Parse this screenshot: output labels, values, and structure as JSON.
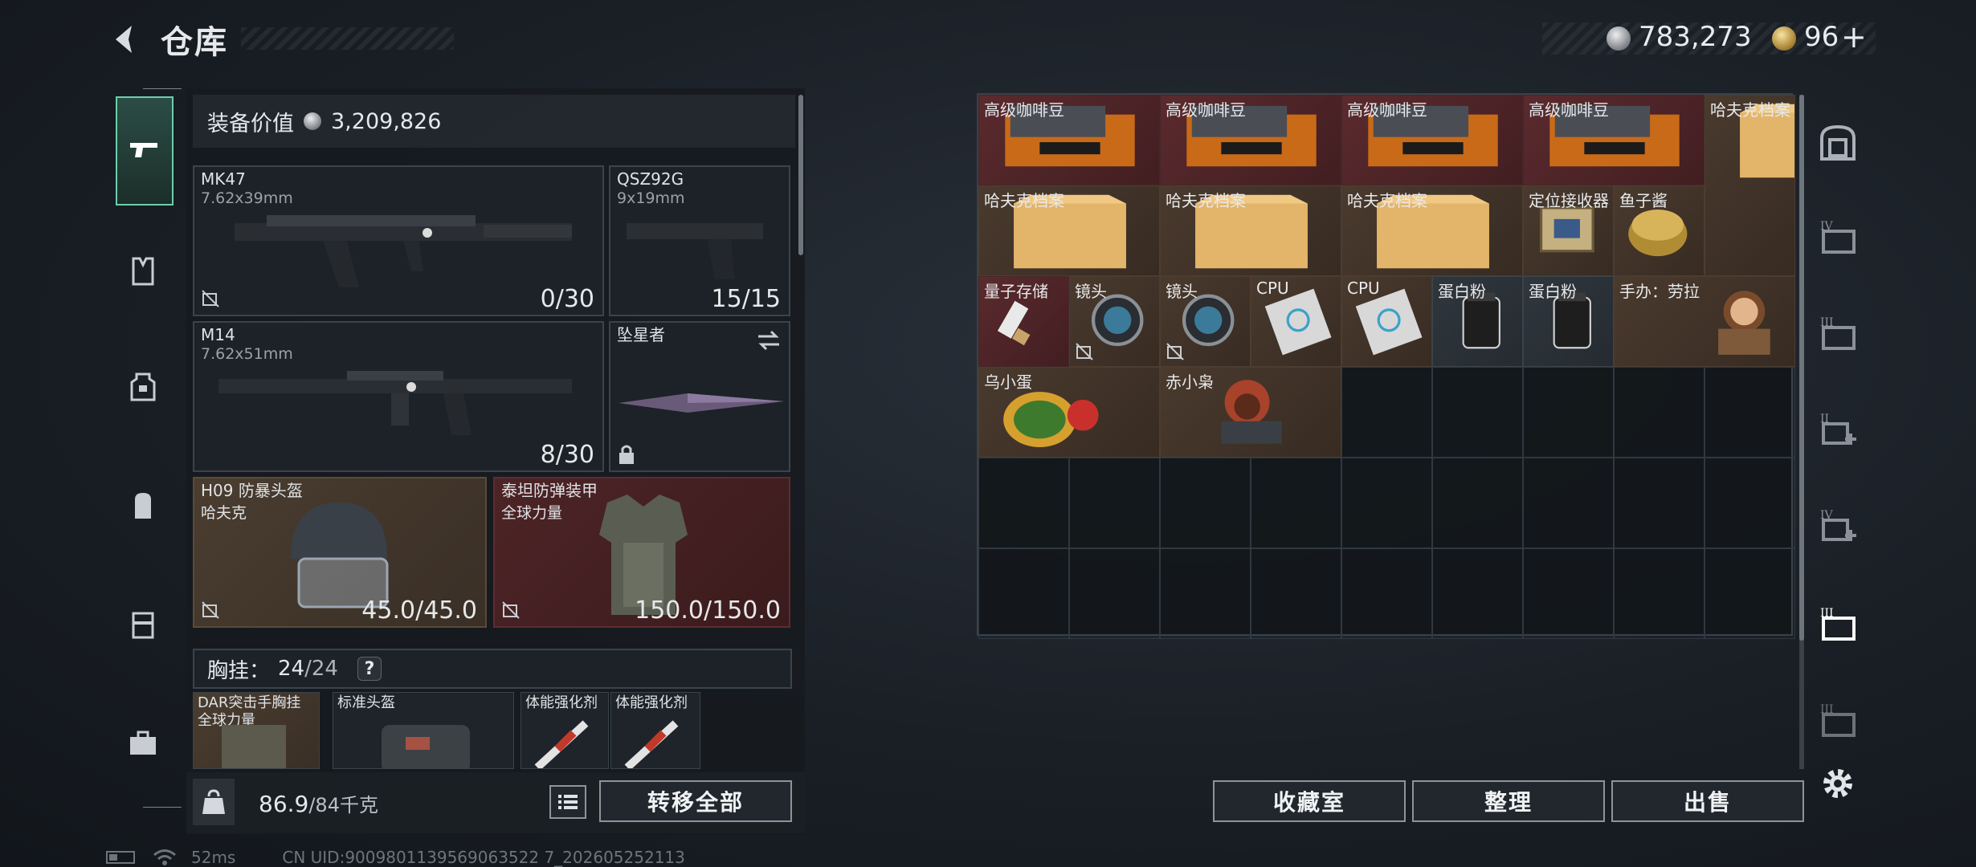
{
  "header": {
    "title": "仓库",
    "silver_amount": "783,273",
    "gold_amount": "96",
    "gold_add": "+"
  },
  "left": {
    "value_label": "装备价值",
    "value_amount": "3,209,826",
    "weapons": [
      {
        "name": "MK47",
        "sub": "7.62x39mm",
        "count": "0/30"
      },
      {
        "name": "QSZ92G",
        "sub": "9x19mm",
        "count": "15/15"
      },
      {
        "name": "M14",
        "sub": "7.62x51mm",
        "count": "8/30"
      },
      {
        "name": "坠星者",
        "sub": "",
        "count": ""
      }
    ],
    "armor": [
      {
        "name": "H09 防暴头盔",
        "sub": "哈夫克",
        "count": "45.0/45.0"
      },
      {
        "name": "泰坦防弹装甲",
        "sub": "全球力量",
        "count": "150.0/150.0"
      }
    ],
    "chest": {
      "label": "胸挂：",
      "current": "24",
      "max": "/24",
      "help": "?"
    },
    "chest_items": [
      {
        "name": "DAR突击手胸挂\n全球力量"
      },
      {
        "name": "标准头盔"
      },
      {
        "name": "体能强化剂"
      },
      {
        "name": "体能强化剂"
      }
    ],
    "weight_current": "86.9",
    "weight_max": "/84千克",
    "transfer_all": "转移全部"
  },
  "stash": {
    "items": [
      {
        "name": "高级咖啡豆",
        "color": "red",
        "col": 0,
        "row": 0,
        "w": 2,
        "h": 1,
        "icon": "coffee-box-icon"
      },
      {
        "name": "高级咖啡豆",
        "color": "red",
        "col": 2,
        "row": 0,
        "w": 2,
        "h": 1,
        "icon": "coffee-box-icon"
      },
      {
        "name": "高级咖啡豆",
        "color": "red",
        "col": 4,
        "row": 0,
        "w": 2,
        "h": 1,
        "icon": "coffee-box-icon"
      },
      {
        "name": "高级咖啡豆",
        "color": "red",
        "col": 6,
        "row": 0,
        "w": 2,
        "h": 1,
        "icon": "coffee-box-icon"
      },
      {
        "name": "哈夫克档案",
        "color": "brown",
        "col": 8,
        "row": 0,
        "w": 1,
        "h": 2,
        "icon": "folder-icon"
      },
      {
        "name": "哈夫克档案",
        "color": "brown",
        "col": 0,
        "row": 1,
        "w": 2,
        "h": 1,
        "icon": "folder-icon"
      },
      {
        "name": "哈夫克档案",
        "color": "brown",
        "col": 2,
        "row": 1,
        "w": 2,
        "h": 1,
        "icon": "folder-icon"
      },
      {
        "name": "哈夫克档案",
        "color": "brown",
        "col": 4,
        "row": 1,
        "w": 2,
        "h": 1,
        "icon": "folder-icon"
      },
      {
        "name": "定位接收器",
        "color": "brown",
        "col": 6,
        "row": 1,
        "w": 1,
        "h": 1,
        "icon": "receiver-icon"
      },
      {
        "name": "鱼子酱",
        "color": "brown",
        "col": 7,
        "row": 1,
        "w": 1,
        "h": 1,
        "icon": "caviar-icon"
      },
      {
        "name": "量子存储",
        "color": "red",
        "col": 0,
        "row": 2,
        "w": 1,
        "h": 1,
        "icon": "usb-icon"
      },
      {
        "name": "镜头",
        "color": "brown",
        "col": 1,
        "row": 2,
        "w": 1,
        "h": 1,
        "icon": "lens-icon",
        "noins": true
      },
      {
        "name": "镜头",
        "color": "brown",
        "col": 2,
        "row": 2,
        "w": 1,
        "h": 1,
        "icon": "lens-icon",
        "noins": true
      },
      {
        "name": "CPU",
        "color": "brown",
        "col": 3,
        "row": 2,
        "w": 1,
        "h": 1,
        "icon": "cpu-icon"
      },
      {
        "name": "CPU",
        "color": "brown",
        "col": 4,
        "row": 2,
        "w": 1,
        "h": 1,
        "icon": "cpu-icon"
      },
      {
        "name": "蛋白粉",
        "color": "gray",
        "col": 5,
        "row": 2,
        "w": 1,
        "h": 1,
        "icon": "protein-icon"
      },
      {
        "name": "蛋白粉",
        "color": "gray",
        "col": 6,
        "row": 2,
        "w": 1,
        "h": 1,
        "icon": "protein-icon"
      },
      {
        "name": "手办：劳拉",
        "color": "brown",
        "col": 7,
        "row": 2,
        "w": 2,
        "h": 1,
        "icon": "figure-icon"
      },
      {
        "name": "乌小蛋",
        "color": "brown",
        "col": 0,
        "row": 3,
        "w": 2,
        "h": 1,
        "icon": "egg-figure-icon"
      },
      {
        "name": "赤小枭",
        "color": "brown",
        "col": 2,
        "row": 3,
        "w": 2,
        "h": 1,
        "icon": "owl-figure-icon"
      }
    ],
    "buttons": {
      "collection": "收藏室",
      "organize": "整理",
      "sell": "出售"
    }
  },
  "status": {
    "ping": "52ms",
    "uid": "CN UID:9009801139569063522 7_202605252113"
  }
}
